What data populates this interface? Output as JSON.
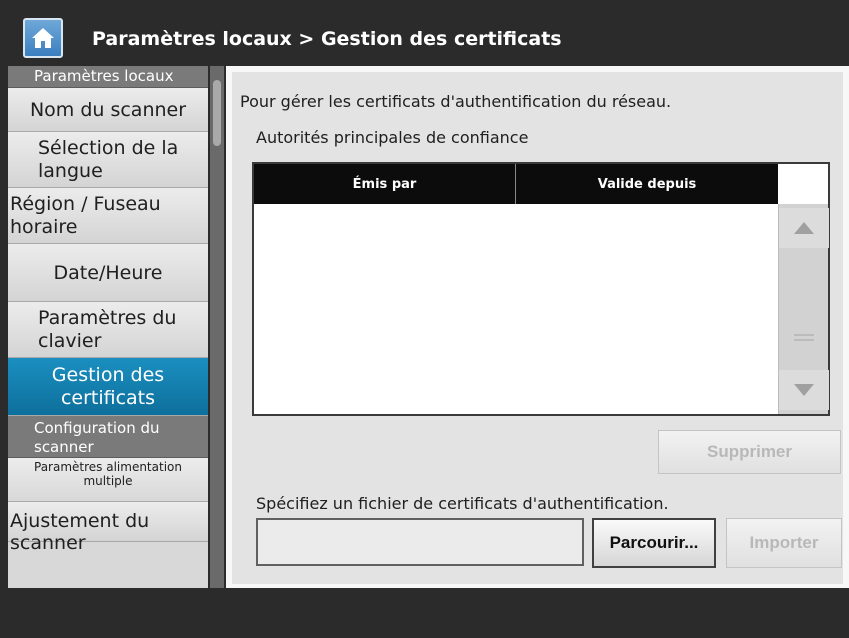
{
  "header": {
    "title": "Paramètres locaux > Gestion des certificats",
    "home_icon": "home-icon"
  },
  "sidebar": {
    "category_local": "Paramètres locaux",
    "items": [
      {
        "label": "Nom du scanner"
      },
      {
        "label": "Sélection de la langue"
      },
      {
        "label": "Région / Fuseau horaire"
      },
      {
        "label": "Date/Heure"
      },
      {
        "label": "Paramètres du clavier"
      },
      {
        "label": "Gestion des certificats",
        "active": true
      }
    ],
    "category_scanner": "Configuration du scanner",
    "sub_item": "Paramètres alimentation multiple",
    "last_item": "Ajustement du scanner"
  },
  "main": {
    "description": "Pour gérer les certificats d'authentification du réseau.",
    "trusted_heading": "Autorités principales de confiance",
    "table": {
      "columns": [
        "Émis par",
        "Valide depuis"
      ],
      "rows": []
    },
    "delete_button": "Supprimer",
    "file_label": "Spécifiez un fichier de certificats d'authentification.",
    "file_value": "",
    "browse_button": "Parcourir...",
    "import_button": "Importer"
  },
  "colors": {
    "active_item": "#0e6f9c",
    "header_bg": "#2b2b2b"
  }
}
